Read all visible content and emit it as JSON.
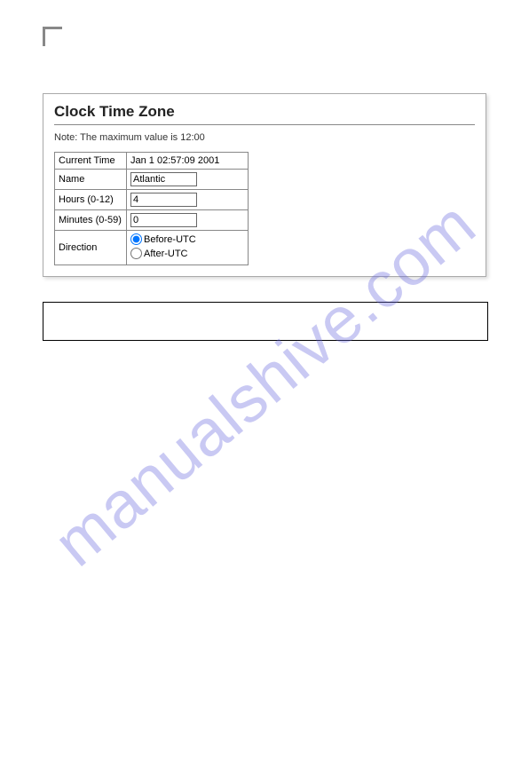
{
  "watermark": "manualshive.com",
  "panel": {
    "title": "Clock Time Zone",
    "note": "Note: The maximum value is 12:00",
    "rows": {
      "currentTime": {
        "label": "Current Time",
        "value": "Jan 1 02:57:09 2001"
      },
      "name": {
        "label": "Name",
        "value": "Atlantic"
      },
      "hours": {
        "label": "Hours (0-12)",
        "value": "4"
      },
      "minutes": {
        "label": "Minutes (0-59)",
        "value": "0"
      },
      "direction": {
        "label": "Direction",
        "before": "Before-UTC",
        "after": "After-UTC",
        "selected": "before"
      }
    }
  }
}
